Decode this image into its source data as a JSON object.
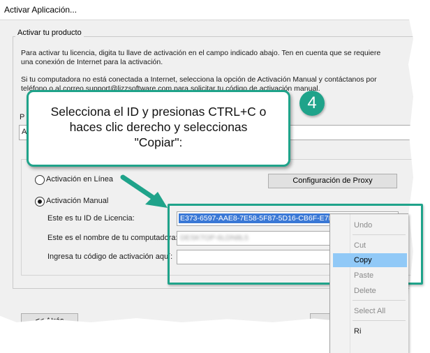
{
  "window": {
    "title": "Activar Aplicación..."
  },
  "group": {
    "legend": "Activar tu producto"
  },
  "paragraphs": {
    "p1_line1": "Para activar tu licencia, digita tu llave de activación en el campo indicado abajo.  Ten en cuenta que se requiere",
    "p1_line2": "una conexión de Internet para la activación.",
    "p2_line1": "Si tu computadora no está conectada a Internet, selecciona la opción de Activación Manual y contáctanos por",
    "p2_line2": "teléfono o al correo support@lizzsoftware.com para solicitar tu código de activación manual."
  },
  "key_field": {
    "label": "P",
    "value": "A"
  },
  "options": {
    "online_label": "Activación en Línea",
    "manual_label": "Activación Manual",
    "selected": "manual"
  },
  "proxy_button": {
    "label": "Configuración de Proxy"
  },
  "manual": {
    "license_id_label": "Este es tu ID de Licencia:",
    "license_id_value": "E373-6597-AAE8-7E58-5F87-5D16-CB6F-E7E",
    "computer_name_label": "Este es el nombre de tu computadora:",
    "computer_name_value": "DESKTOP-6LDN8L5",
    "activation_code_label": "Ingresa tu código de activación aquí:",
    "activation_code_value": ""
  },
  "nav": {
    "back_label": "<< Atrás"
  },
  "context_menu": {
    "items": [
      {
        "label": "Undo",
        "state": "disabled"
      },
      {
        "label": "Cut",
        "state": "disabled"
      },
      {
        "label": "Copy",
        "state": "highlighted"
      },
      {
        "label": "Paste",
        "state": "disabled"
      },
      {
        "label": "Delete",
        "state": "disabled"
      },
      {
        "label": "Select All",
        "state": "disabled"
      },
      {
        "label": "Ri",
        "state": "normal"
      }
    ]
  },
  "callout": {
    "line1": "Selecciona el ID y presionas CTRL+C o",
    "line2": "haces clic derecho y seleccionas",
    "line3": "\"Copiar\":",
    "step_number": "4"
  },
  "colors": {
    "accent": "#1fa38a",
    "selection": "#3a78d6",
    "menu_highlight": "#91c9f7"
  }
}
